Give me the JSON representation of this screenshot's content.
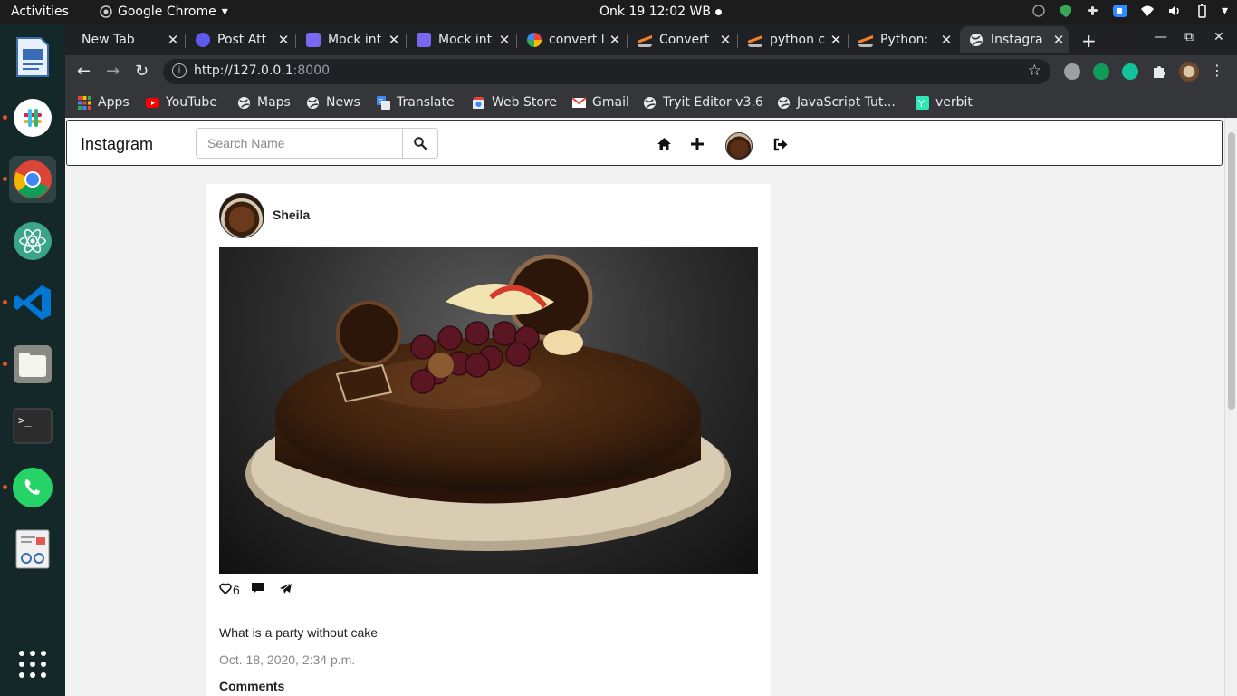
{
  "os": {
    "activities": "Activities",
    "app_name": "Google Chrome",
    "clock": "Onk 19  12:02 WB"
  },
  "browser": {
    "tabs": [
      {
        "label": "New Tab",
        "icon": "none"
      },
      {
        "label": "Post Att",
        "icon": "zoom-icon"
      },
      {
        "label": "Mock int",
        "icon": "docs-icon"
      },
      {
        "label": "Mock int",
        "icon": "docs-icon"
      },
      {
        "label": "convert l",
        "icon": "google-icon"
      },
      {
        "label": "Convert",
        "icon": "stackoverflow-icon"
      },
      {
        "label": "python c",
        "icon": "stackoverflow-icon"
      },
      {
        "label": "Python:",
        "icon": "stackoverflow-icon"
      },
      {
        "label": "Instagra",
        "icon": "globe-icon"
      }
    ],
    "url_host": "http://127.0.0.1",
    "url_port": ":8000",
    "bookmarks": [
      {
        "label": "Apps",
        "icon": "apps-grid-icon"
      },
      {
        "label": "YouTube",
        "icon": "youtube-icon"
      },
      {
        "label": "Maps",
        "icon": "globe-icon"
      },
      {
        "label": "News",
        "icon": "globe-icon"
      },
      {
        "label": "Translate",
        "icon": "translate-icon"
      },
      {
        "label": "Web Store",
        "icon": "webstore-icon"
      },
      {
        "label": "Gmail",
        "icon": "gmail-icon"
      },
      {
        "label": "Tryit Editor v3.6",
        "icon": "globe-icon"
      },
      {
        "label": "JavaScript Tut...",
        "icon": "globe-icon"
      },
      {
        "label": "verbit",
        "icon": "verbit-icon"
      }
    ]
  },
  "site": {
    "brand": "Instagram",
    "search_placeholder": "Search Name"
  },
  "post": {
    "username": "Sheila",
    "like_count": "6",
    "caption": "What is a party without cake",
    "timestamp": "Oct. 18, 2020, 2:34 p.m.",
    "comments_heading": "Comments"
  },
  "colors": {
    "dock_bg": "#14282a",
    "chrome_dark": "#202124",
    "chrome_toolbar": "#35363a",
    "page_bg": "#f2f2f2"
  }
}
